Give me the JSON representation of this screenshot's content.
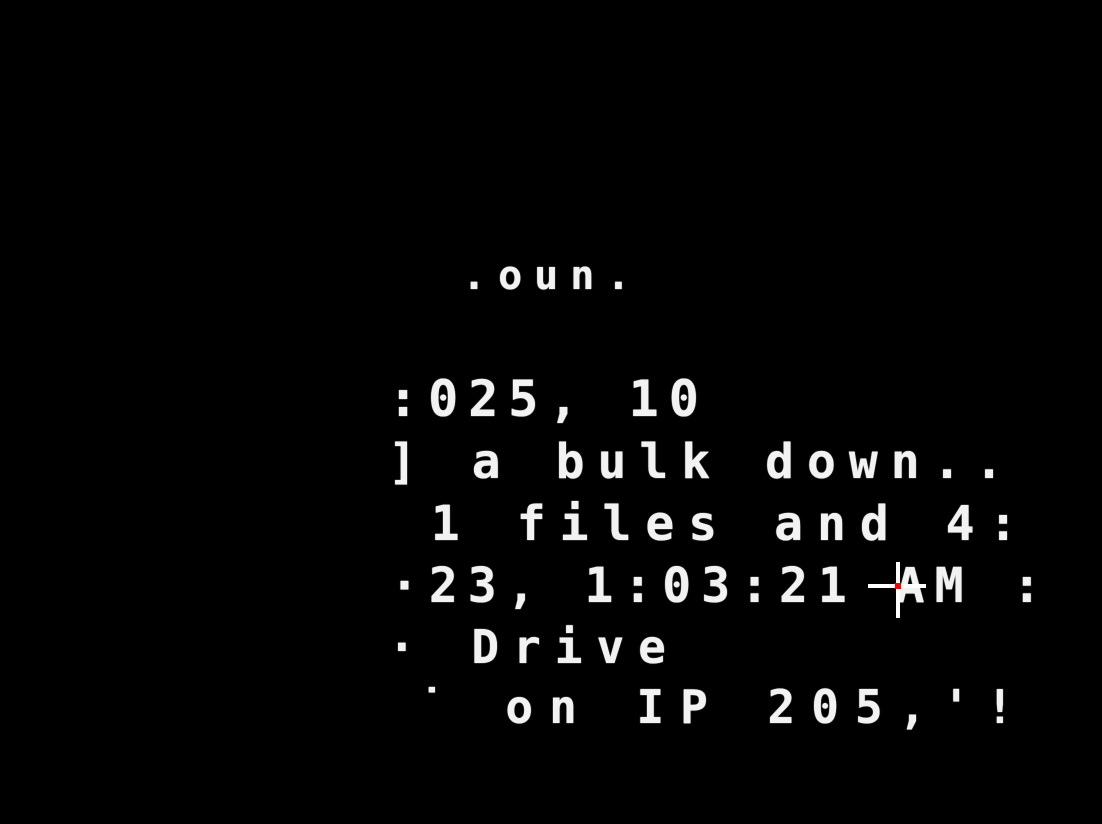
{
  "screen": {
    "background_color": "#000000",
    "text_color": "#ffffff",
    "lines": [
      ".oun.",
      ":025, 10",
      "] a bulk down..",
      " 1 files and 4:",
      "·23, 1:03:21 AM :",
      "· Drive",
      "˙ on IP 205,'!"
    ]
  },
  "cursor": {
    "icon": "crosshair-cursor-icon",
    "dot_color": "#ff0000"
  }
}
